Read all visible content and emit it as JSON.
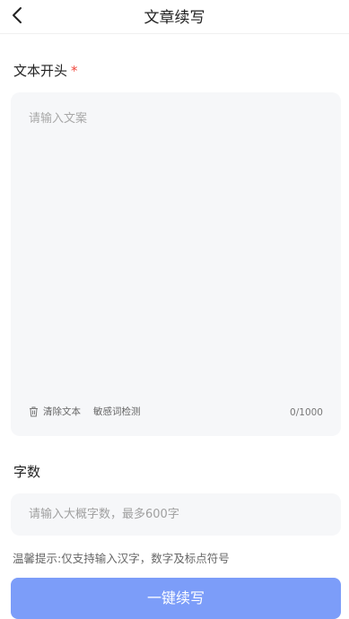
{
  "nav": {
    "title": "文章续写"
  },
  "opening": {
    "label": "文本开头",
    "required_mark": "*",
    "placeholder": "请输入文案",
    "clear_label": "清除文本",
    "sensitive_label": "敏感词检测",
    "counter": "0/1000"
  },
  "word_count": {
    "label": "字数",
    "placeholder": "请输入大概字数，最多600字"
  },
  "tip": "温馨提示:仅支持输入汉字，数字及标点符号",
  "submit_label": "一键续写",
  "colors": {
    "accent": "#7c9df9",
    "required": "#f0473c",
    "field_bg": "#f6f7f9"
  },
  "icons": [
    "chevron-left-icon",
    "trash-icon"
  ]
}
